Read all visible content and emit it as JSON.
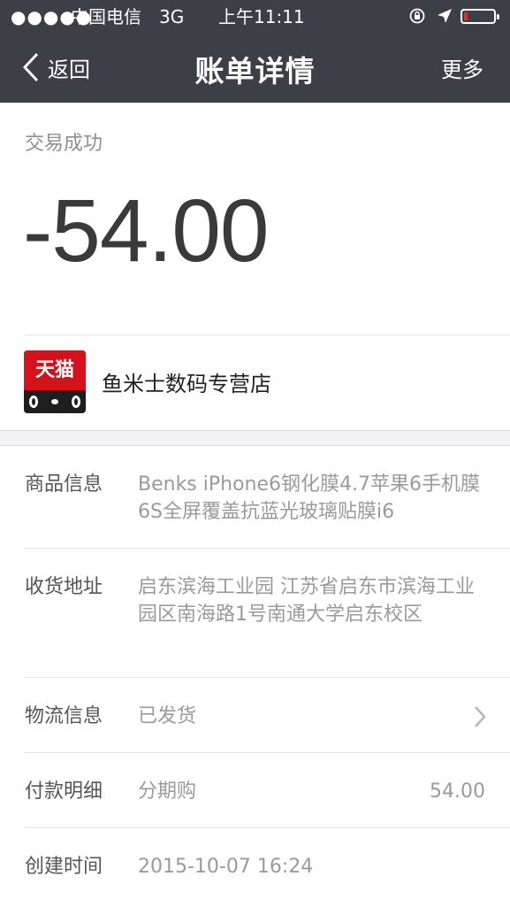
{
  "status_bar": {
    "signal": "●●●●●",
    "carrier": "中国电信",
    "network": "3G",
    "time": "上午11:11"
  },
  "nav": {
    "back_label": "返回",
    "title": "账单详情",
    "more_label": "更多"
  },
  "summary": {
    "status": "交易成功",
    "amount": "-54.00",
    "shop_name": "鱼米士数码专营店",
    "shop_logo_text": "天猫"
  },
  "details": [
    {
      "key": "商品信息",
      "value": "Benks iPhone6钢化膜4.7苹果6手机膜6S全屏覆盖抗蓝光玻璃贴膜i6"
    },
    {
      "key": "收货地址",
      "value": "启东滨海工业园 江苏省启东市滨海工业园区南海路1号南通大学启东校区"
    },
    {
      "key": "物流信息",
      "value": "已发货"
    },
    {
      "key": "付款明细",
      "value": "分期购",
      "amount": "54.00"
    },
    {
      "key": "创建时间",
      "value": "2015-10-07 16:24"
    }
  ],
  "colors": {
    "nav_bg": "#3c3f46",
    "tmall_red": "#d3121c",
    "battery_low": "#e0302a"
  },
  "icons": [
    "lock-rotation-icon",
    "location-arrow-icon",
    "battery-icon",
    "back-chevron-icon",
    "chevron-right-icon"
  ]
}
